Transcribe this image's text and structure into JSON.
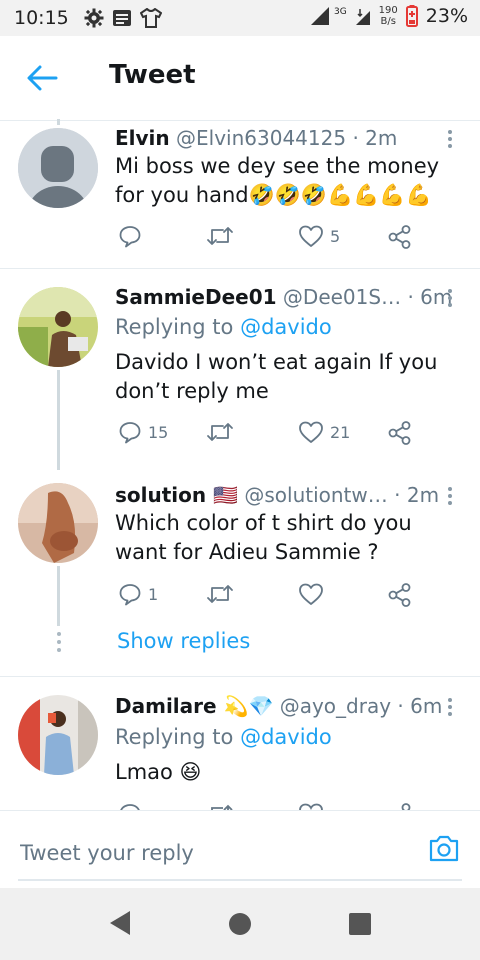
{
  "status_bar": {
    "time": "10:15",
    "network": "3G",
    "net_speed_value": "190",
    "net_speed_unit": "B/s",
    "battery": "23%"
  },
  "header": {
    "title": "Tweet"
  },
  "tweets": [
    {
      "name": "Elvin",
      "handle": "@Elvin63044125",
      "time": "· 2m",
      "text": "Mi boss we dey see the money for you hand🤣🤣🤣💪💪💪💪",
      "reply_count": "",
      "retweet_count": "",
      "like_count": "5"
    },
    {
      "name": "SammieDee01",
      "handle": "@Dee01S…",
      "time": "· 6m",
      "replying_prefix": "Replying to ",
      "replying_to": "@davido",
      "text": "Davido I won’t eat again If you don’t reply me",
      "reply_count": "15",
      "retweet_count": "",
      "like_count": "21"
    },
    {
      "name": "solution 🇺🇸",
      "handle": "@solutiontw…",
      "time": "· 2m",
      "text": "Which color of t shirt do you want for Adieu Sammie ?",
      "reply_count": "1",
      "retweet_count": "",
      "like_count": ""
    },
    {
      "name": "Damilare 💫💎",
      "handle": "@ayo_dray",
      "time": "· 6m",
      "replying_prefix": "Replying to ",
      "replying_to": "@davido",
      "text": "Lmao 😆"
    }
  ],
  "show_replies_label": "Show replies",
  "reply_bar": {
    "placeholder": "Tweet your reply"
  },
  "colors": {
    "accent": "#1da1f2",
    "secondary_text": "#657786",
    "divider": "#e6ecf0"
  },
  "icons": [
    "back-arrow-icon",
    "reply-icon",
    "retweet-icon",
    "like-icon",
    "share-icon",
    "more-icon",
    "camera-icon",
    "nav-back-icon",
    "nav-home-icon",
    "nav-recents-icon"
  ]
}
